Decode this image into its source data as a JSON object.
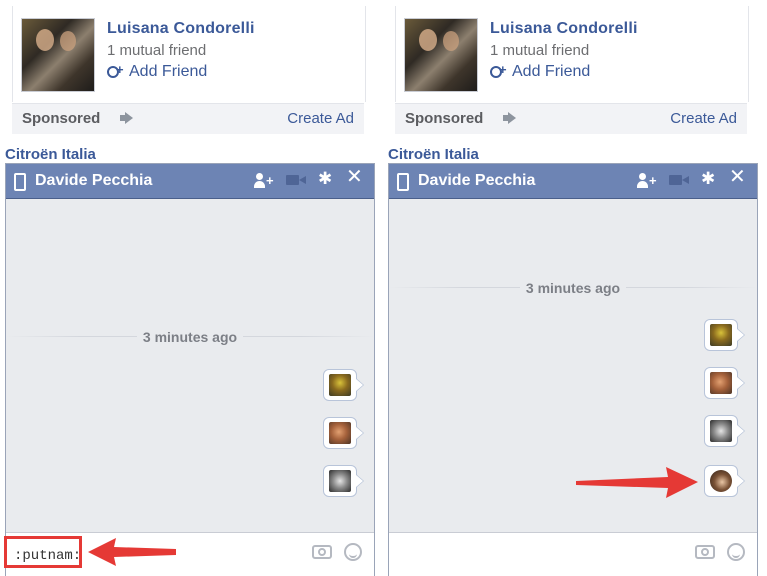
{
  "panels": {
    "left": {
      "suggestion": {
        "name": "Luisana Condorelli",
        "mutual": "1 mutual friend",
        "add_friend": "Add Friend"
      },
      "ads": {
        "sponsored": "Sponsored",
        "create_ad": "Create Ad",
        "advertiser": "Citroën Italia"
      },
      "chat": {
        "title": "Davide Pecchia",
        "timestamp": "3 minutes ago",
        "input_value": ":putnam:",
        "stickers": [
          "sticker-1",
          "sticker-2",
          "sticker-3"
        ]
      }
    },
    "right": {
      "suggestion": {
        "name": "Luisana Condorelli",
        "mutual": "1 mutual friend",
        "add_friend": "Add Friend"
      },
      "ads": {
        "sponsored": "Sponsored",
        "create_ad": "Create Ad",
        "advertiser": "Citroën Italia"
      },
      "chat": {
        "title": "Davide Pecchia",
        "timestamp": "3 minutes ago",
        "input_value": "",
        "stickers": [
          "sticker-1",
          "sticker-2",
          "sticker-3",
          "sticker-4"
        ]
      }
    }
  },
  "colors": {
    "facebook_blue": "#3b5998",
    "chat_header": "#6d84b4",
    "annotation_red": "#e53935"
  },
  "icons": {
    "header": [
      "mobile-icon",
      "add-people-icon",
      "video-icon",
      "gear-icon",
      "close-icon"
    ],
    "input": [
      "camera-icon",
      "emoji-icon"
    ],
    "ads": [
      "megaphone-icon",
      "add-friend-icon"
    ]
  }
}
